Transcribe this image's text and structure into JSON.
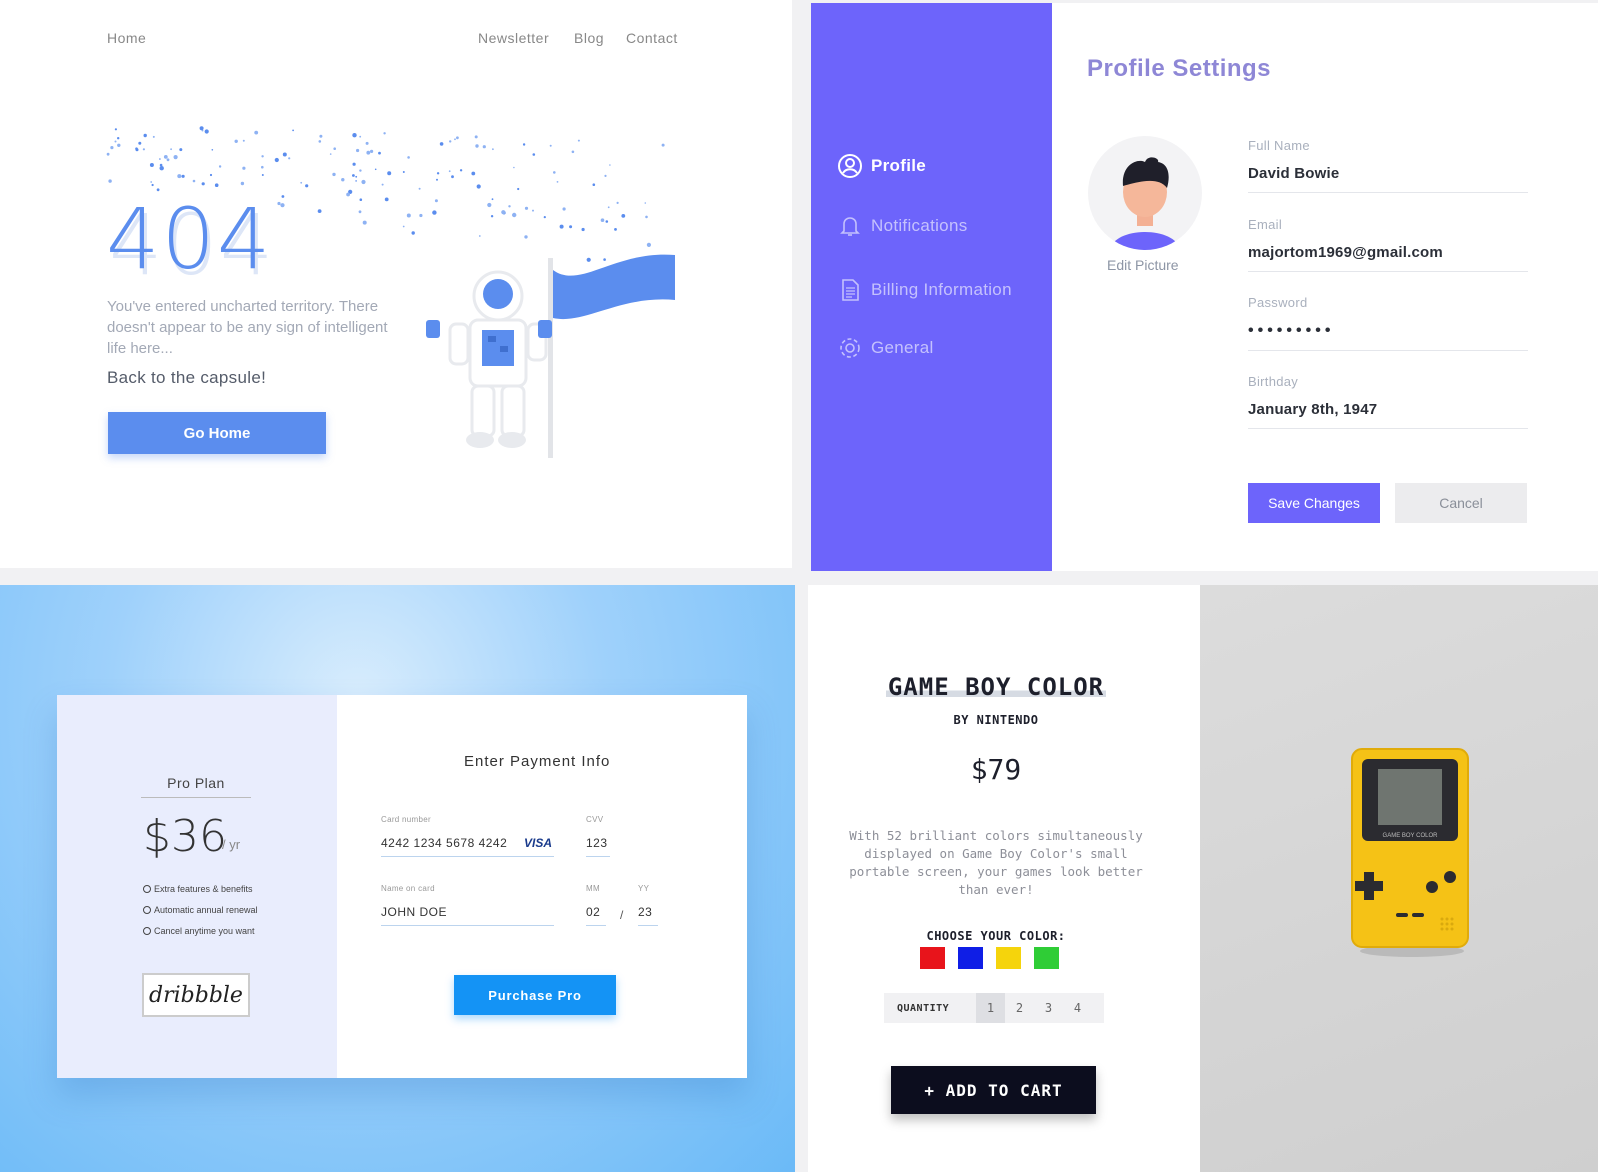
{
  "p404": {
    "nav": {
      "home": "Home",
      "newsletter": "Newsletter",
      "blog": "Blog",
      "contact": "Contact"
    },
    "code": "404",
    "message": "You've entered uncharted territory. There doesn't appear to be any sign of intelligent life here...",
    "back": "Back to the capsule!",
    "button": "Go Home",
    "accent": "#5b8dee"
  },
  "profile": {
    "sidebar": [
      {
        "label": "Profile",
        "icon": "user-circle-icon"
      },
      {
        "label": "Notifications",
        "icon": "bell-icon"
      },
      {
        "label": "Billing Information",
        "icon": "document-icon"
      },
      {
        "label": "General",
        "icon": "gear-icon"
      }
    ],
    "title": "Profile Settings",
    "edit_picture": "Edit Picture",
    "fields": [
      {
        "label": "Full Name",
        "value": "David Bowie"
      },
      {
        "label": "Email",
        "value": "majortom1969@gmail.com"
      },
      {
        "label": "Password",
        "value": "•••••••••"
      },
      {
        "label": "Birthday",
        "value": "January 8th, 1947"
      }
    ],
    "save": "Save Changes",
    "cancel": "Cancel",
    "accent": "#6d64fb"
  },
  "payment": {
    "plan_name": "Pro Plan",
    "price": "$36",
    "per": "/ yr",
    "features": [
      "Extra features & benefits",
      "Automatic annual renewal",
      "Cancel anytime you want"
    ],
    "brand": "dribbble",
    "title": "Enter Payment Info",
    "card_number_label": "Card number",
    "card_number": "4242 1234 5678 4242",
    "card_brand": "VISA",
    "cvv_label": "CVV",
    "cvv": "123",
    "name_label": "Name on card",
    "name": "JOHN DOE",
    "mm_label": "MM",
    "mm": "02",
    "yy_label": "YY",
    "yy": "23",
    "separator": "/",
    "button": "Purchase Pro",
    "accent": "#1493f5"
  },
  "product": {
    "title": "GAME BOY COLOR",
    "by": "BY NINTENDO",
    "price": "$79",
    "description": "With 52 brilliant colors simultaneously displayed on Game Boy Color's small portable screen, your games look better than ever!",
    "choose_label": "CHOOSE YOUR COLOR:",
    "colors": [
      "#e8141b",
      "#0f1ee6",
      "#f5d40c",
      "#2fcd36"
    ],
    "quantity_label": "QUANTITY",
    "quantities": [
      "1",
      "2",
      "3",
      "4"
    ],
    "selected_quantity": "1",
    "cart_button": "+ ADD TO CART",
    "device_brand": "GAME BOY COLOR"
  }
}
